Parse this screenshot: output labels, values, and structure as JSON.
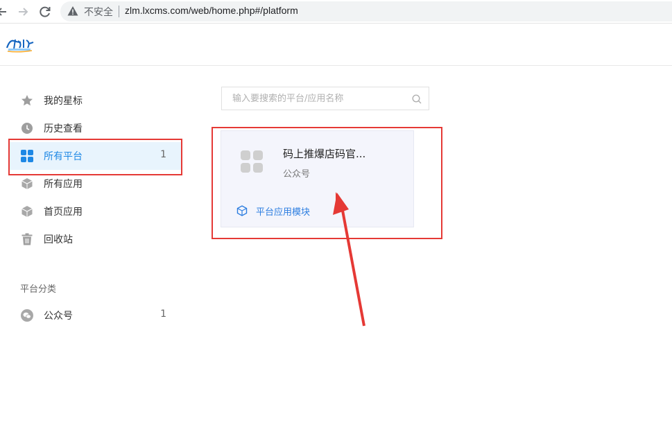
{
  "browser": {
    "back_icon": "arrow-left",
    "forward_icon": "arrow-right",
    "reload_icon": "reload",
    "security_label": "不安全",
    "url": "zlm.lxcms.com/web/home.php#/platform"
  },
  "header": {
    "logo_icon": "brand-logo"
  },
  "sidebar": {
    "items": [
      {
        "label": "我的星标",
        "icon": "star-icon"
      },
      {
        "label": "历史查看",
        "icon": "clock-icon"
      },
      {
        "label": "所有平台",
        "icon": "grid-icon",
        "count": "1",
        "active": true
      },
      {
        "label": "所有应用",
        "icon": "cube-icon"
      },
      {
        "label": "首页应用",
        "icon": "cube-icon"
      },
      {
        "label": "回收站",
        "icon": "trash-icon"
      }
    ],
    "section_title": "平台分类",
    "categories": [
      {
        "label": "公众号",
        "icon": "wechat-icon",
        "count": "1"
      }
    ]
  },
  "search": {
    "placeholder": "输入要搜索的平台/应用名称",
    "value": ""
  },
  "platforms": [
    {
      "name": "码上推爆店码官...",
      "type": "公众号",
      "link_label": "平台应用模块"
    }
  ],
  "colors": {
    "accent": "#1e88e5",
    "annotation": "#e53935",
    "card_bg": "#f4f5fc"
  }
}
